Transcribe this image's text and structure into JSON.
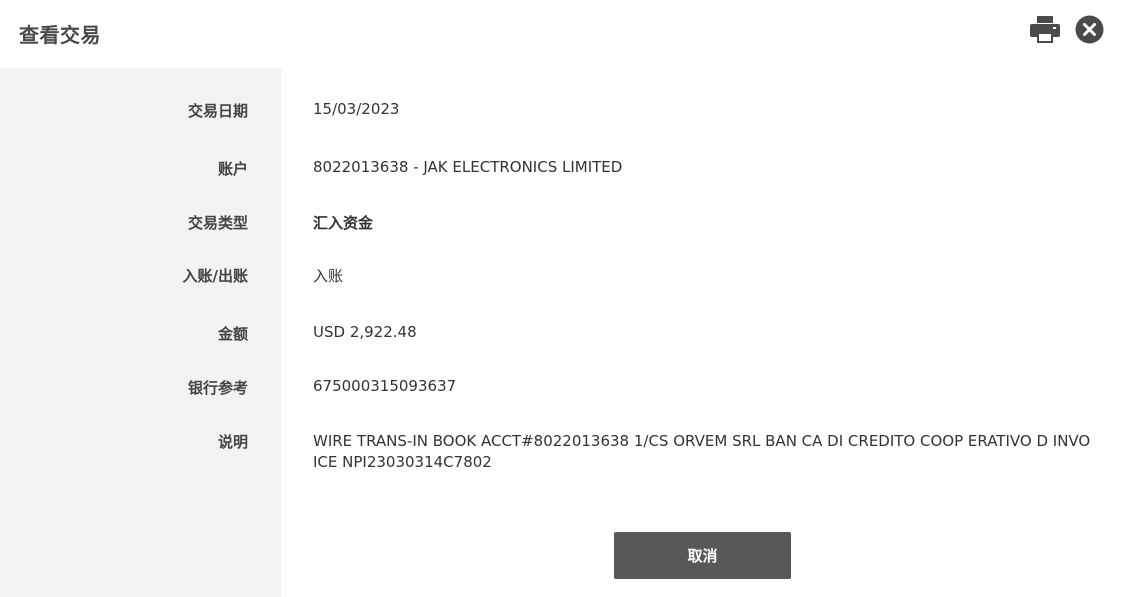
{
  "header": {
    "title": "查看交易",
    "print_icon": "printer-icon",
    "close_icon": "close-circle-icon"
  },
  "fields": [
    {
      "label": "交易日期",
      "value": "15/03/2023"
    },
    {
      "label": "账户",
      "value": "8022013638 - JAK ELECTRONICS LIMITED"
    },
    {
      "label": "交易类型",
      "value": "汇入资金"
    },
    {
      "label": "入账/出账",
      "value": "入账"
    },
    {
      "label": "金额",
      "value": "USD 2,922.48"
    },
    {
      "label": "银行参考",
      "value": "675000315093637"
    },
    {
      "label": "说明",
      "value": "WIRE TRANS-IN BOOK ACCT#8022013638 1/CS ORVEM SRL BAN CA DI CREDITO COOP ERATIVO D INVOICE NPI23030314C7802"
    }
  ],
  "footer": {
    "cancel_label": "取消"
  },
  "colors": {
    "icon": "#4a4a4a",
    "sidebar_bg": "#f2f2f2",
    "button_bg": "#585858",
    "button_text": "#ffffff"
  }
}
